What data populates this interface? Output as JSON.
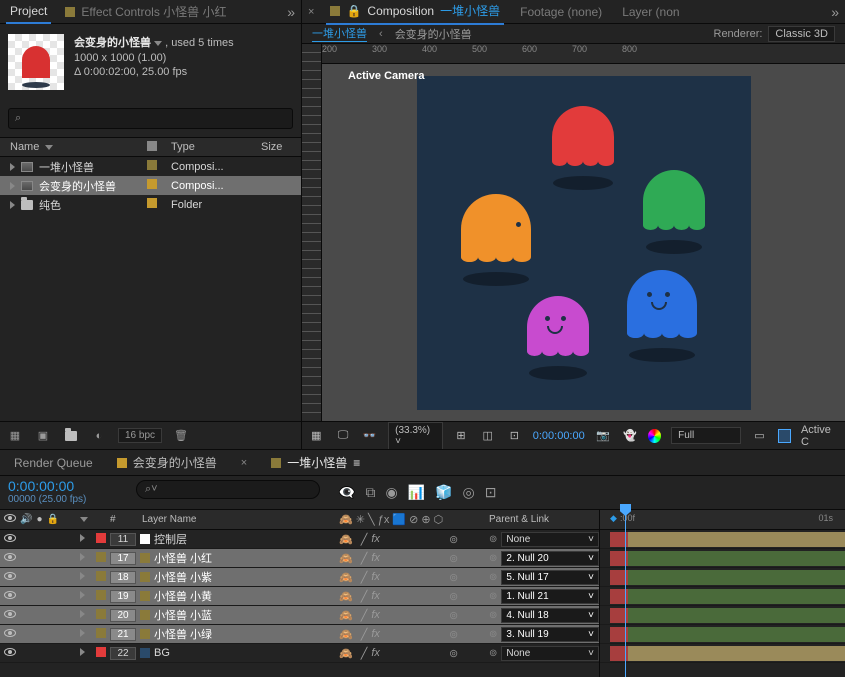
{
  "panels": {
    "project_tab": "Project",
    "effect_controls_tab": "Effect Controls 小怪兽 小红",
    "composition_tab": "Composition",
    "composition_name": "一堆小怪兽",
    "footage_tab": "Footage (none)",
    "layer_tab": "Layer (non",
    "renderer_label": "Renderer:",
    "renderer_value": "Classic 3D"
  },
  "flowchart": {
    "active": "一堆小怪兽",
    "crumb": "会变身的小怪兽"
  },
  "proj_item": {
    "name": "会变身的小怪兽",
    "used": ", used 5 times",
    "dims": "1000 x 1000 (1.00)",
    "dur": "Δ 0:00:02:00, 25.00 fps"
  },
  "search_placeholder": "",
  "proj_cols": {
    "name": "Name",
    "type": "Type",
    "size": "Size"
  },
  "proj_rows": [
    {
      "name": "一堆小怪兽",
      "type": "Composi...",
      "color": "#8a7a3a",
      "icon": "comp",
      "sel": false
    },
    {
      "name": "会变身的小怪兽",
      "type": "Composi...",
      "color": "#c59a2e",
      "icon": "comp",
      "sel": true
    },
    {
      "name": "纯色",
      "type": "Folder",
      "color": "#c59a2e",
      "icon": "folder",
      "sel": false
    }
  ],
  "bpc": "16 bpc",
  "ruler_h": [
    "200",
    "300",
    "400",
    "500",
    "600",
    "700",
    "800"
  ],
  "active_camera": "Active Camera",
  "comp_foot": {
    "zoom": "(33.3%)",
    "timecode": "0:00:00:00",
    "full": "Full",
    "active_cam": "Active C"
  },
  "timeline": {
    "tabs": {
      "render_queue": "Render Queue",
      "comp1": "会变身的小怪兽",
      "comp2": "一堆小怪兽"
    },
    "timecode": "0:00:00:00",
    "frame_info": "00000 (25.00 fps)",
    "cols": {
      "num": "#",
      "layer": "Layer Name",
      "parent": "Parent & Link"
    },
    "time_marks": {
      "m0": ":00f",
      "m1": "01s"
    },
    "layers": [
      {
        "n": "11",
        "name": "控制层",
        "color": "#e23b3b",
        "sw_color": "#ffffff",
        "parent": "None",
        "sel": false,
        "bar": "#9a8a5a"
      },
      {
        "n": "17",
        "name": "小怪兽  小红",
        "color": "#8a7a3a",
        "sw_color": "#8a7a3a",
        "parent": "2. Null 20",
        "sel": true,
        "bar": "#4a6a3a"
      },
      {
        "n": "18",
        "name": "小怪兽  小紫",
        "color": "#8a7a3a",
        "sw_color": "#8a7a3a",
        "parent": "5. Null 17",
        "sel": true,
        "bar": "#4a6a3a"
      },
      {
        "n": "19",
        "name": "小怪兽  小黄",
        "color": "#8a7a3a",
        "sw_color": "#8a7a3a",
        "parent": "1. Null 21",
        "sel": true,
        "bar": "#4a6a3a"
      },
      {
        "n": "20",
        "name": "小怪兽  小蓝",
        "color": "#8a7a3a",
        "sw_color": "#8a7a3a",
        "parent": "4. Null 18",
        "sel": true,
        "bar": "#4a6a3a"
      },
      {
        "n": "21",
        "name": "小怪兽  小绿",
        "color": "#8a7a3a",
        "sw_color": "#8a7a3a",
        "parent": "3. Null 19",
        "sel": true,
        "bar": "#4a6a3a"
      },
      {
        "n": "22",
        "name": "BG",
        "color": "#e23b3b",
        "sw_color": "#2a4a6a",
        "parent": "None",
        "sel": false,
        "bar": "#9a8a5a"
      }
    ]
  }
}
